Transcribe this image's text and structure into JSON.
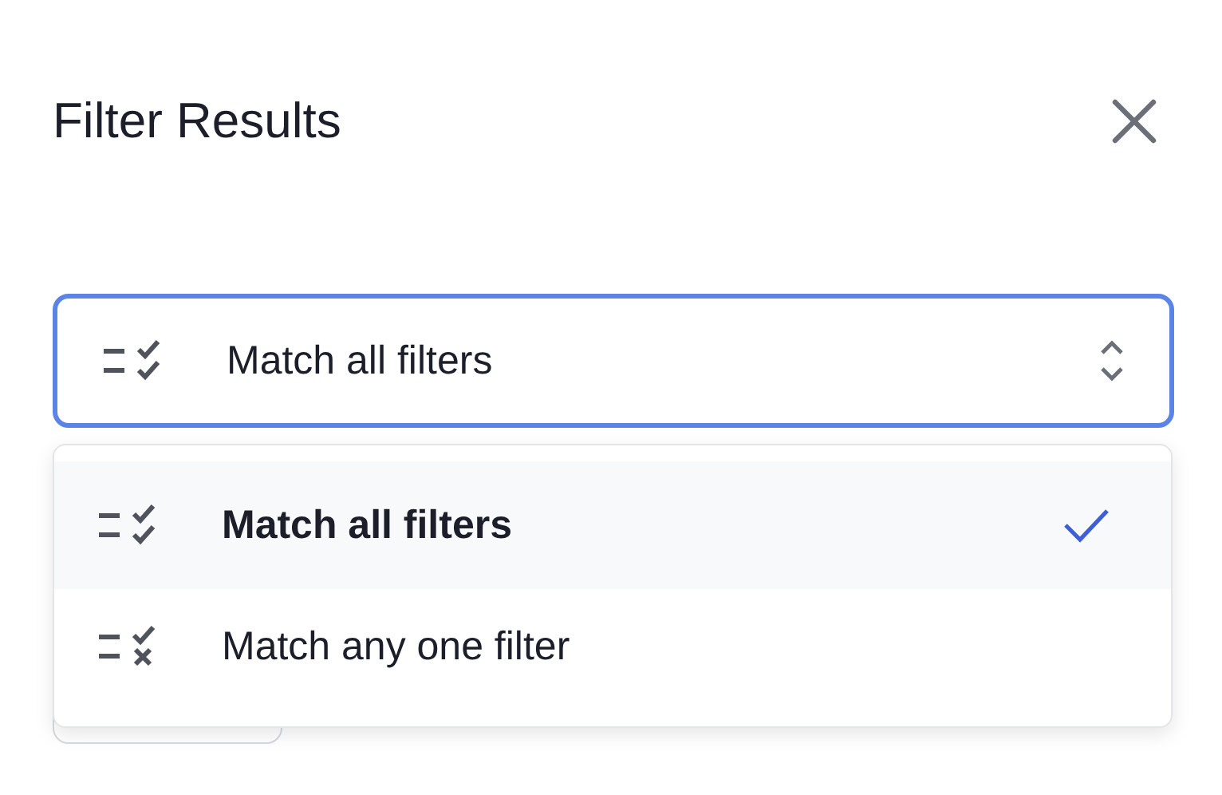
{
  "dialog": {
    "title": "Filter Results"
  },
  "select": {
    "value": "Match all filters",
    "kind": "all",
    "expanded": true
  },
  "options": [
    {
      "label": "Match all filters",
      "kind": "all",
      "selected": true
    },
    {
      "label": "Match any one filter",
      "kind": "any",
      "selected": false
    }
  ]
}
